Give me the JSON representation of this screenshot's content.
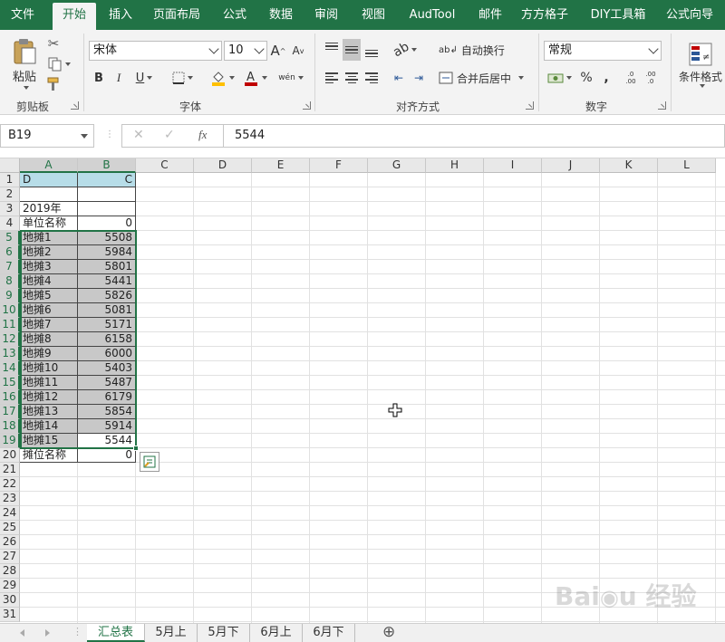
{
  "ribbon": {
    "tabs": [
      "文件",
      "开始",
      "插入",
      "页面布局",
      "公式",
      "数据",
      "审阅",
      "视图",
      "AudTool",
      "邮件",
      "方方格子",
      "DIY工具箱",
      "公式向导"
    ],
    "active_tab": "开始",
    "clipboard": {
      "paste_label": "粘贴",
      "group_label": "剪贴板"
    },
    "font": {
      "name": "宋体",
      "size": "10",
      "bold": "B",
      "italic": "I",
      "underline": "U",
      "grow": "A",
      "shrink": "A",
      "phonetic": "wén",
      "group_label": "字体"
    },
    "alignment": {
      "wrap_label": "自动换行",
      "merge_label": "合并后居中",
      "group_label": "对齐方式"
    },
    "number": {
      "format": "常规",
      "percent": "%",
      "comma": ",",
      "inc_dec": ".0 .00",
      "dec_dec": ".00 .0",
      "group_label": "数字"
    },
    "styles": {
      "conditional_label": "条件格式"
    },
    "colors": {
      "accent": "#217346",
      "highlight": "#ffc000",
      "font_red": "#c00000"
    }
  },
  "formula_bar": {
    "name_box": "B19",
    "cancel": "✕",
    "enter": "✓",
    "fx": "fx",
    "value": "5544"
  },
  "grid": {
    "columns": [
      "A",
      "B",
      "C",
      "D",
      "E",
      "F",
      "G",
      "H",
      "I",
      "J",
      "K",
      "L"
    ],
    "rows": [
      "1",
      "2",
      "3",
      "4",
      "5",
      "6",
      "7",
      "8",
      "9",
      "10",
      "11",
      "12",
      "13",
      "14",
      "15",
      "16",
      "17",
      "18",
      "19",
      "20",
      "21",
      "22",
      "23",
      "24",
      "25",
      "26",
      "27",
      "28",
      "29",
      "30",
      "31"
    ],
    "cells": [
      {
        "r": 1,
        "a": "D",
        "b": "C"
      },
      {
        "r": 2,
        "a": "",
        "b": ""
      },
      {
        "r": 3,
        "a": "2019年",
        "b": ""
      },
      {
        "r": 4,
        "a": "单位名称",
        "b": "0"
      },
      {
        "r": 5,
        "a": "地摊1",
        "b": "5508"
      },
      {
        "r": 6,
        "a": "地摊2",
        "b": "5984"
      },
      {
        "r": 7,
        "a": "地摊3",
        "b": "5801"
      },
      {
        "r": 8,
        "a": "地摊4",
        "b": "5441"
      },
      {
        "r": 9,
        "a": "地摊5",
        "b": "5826"
      },
      {
        "r": 10,
        "a": "地摊6",
        "b": "5081"
      },
      {
        "r": 11,
        "a": "地摊7",
        "b": "5171"
      },
      {
        "r": 12,
        "a": "地摊8",
        "b": "6158"
      },
      {
        "r": 13,
        "a": "地摊9",
        "b": "6000"
      },
      {
        "r": 14,
        "a": "地摊10",
        "b": "5403"
      },
      {
        "r": 15,
        "a": "地摊11",
        "b": "5487"
      },
      {
        "r": 16,
        "a": "地摊12",
        "b": "6179"
      },
      {
        "r": 17,
        "a": "地摊13",
        "b": "5854"
      },
      {
        "r": 18,
        "a": "地摊14",
        "b": "5914"
      },
      {
        "r": 19,
        "a": "地摊15",
        "b": "5544"
      },
      {
        "r": 20,
        "a": "摊位名称",
        "b": "0"
      }
    ],
    "selected_range": "A5:B19",
    "active_cell": "B19"
  },
  "sheet_tabs": [
    "汇总表",
    "5月上",
    "5月下",
    "6月上",
    "6月下"
  ],
  "active_sheet": "汇总表",
  "add_sheet": "⊕"
}
